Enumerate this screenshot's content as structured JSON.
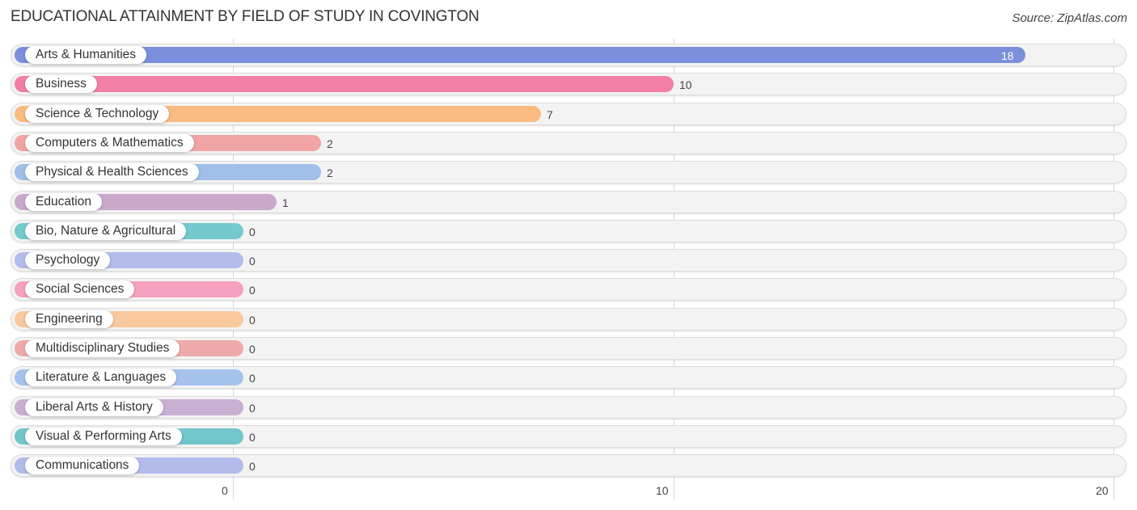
{
  "header": {
    "title": "EDUCATIONAL ATTAINMENT BY FIELD OF STUDY IN COVINGTON",
    "source": "Source: ZipAtlas.com"
  },
  "chart_data": {
    "type": "bar",
    "orientation": "horizontal",
    "title": "EDUCATIONAL ATTAINMENT BY FIELD OF STUDY IN COVINGTON",
    "xlabel": "",
    "ylabel": "",
    "xlim": [
      0,
      20
    ],
    "xticks": [
      0,
      10,
      20
    ],
    "grid": true,
    "categories": [
      "Arts & Humanities",
      "Business",
      "Science & Technology",
      "Computers & Mathematics",
      "Physical & Health Sciences",
      "Education",
      "Bio, Nature & Agricultural",
      "Psychology",
      "Social Sciences",
      "Engineering",
      "Multidisciplinary Studies",
      "Literature & Languages",
      "Liberal Arts & History",
      "Visual & Performing Arts",
      "Communications"
    ],
    "values": [
      18,
      10,
      7,
      2,
      2,
      1,
      0,
      0,
      0,
      0,
      0,
      0,
      0,
      0,
      0
    ],
    "colors": [
      "#7b8fdc",
      "#f47fa6",
      "#f9bb80",
      "#f0a4a4",
      "#a1bfe8",
      "#c9a8cc",
      "#74c9cc",
      "#b3bcea",
      "#f6a0bf",
      "#f9c89c",
      "#eeaaaa",
      "#a5c2ec",
      "#c9afd2",
      "#70c6c9",
      "#b2bbea"
    ]
  }
}
